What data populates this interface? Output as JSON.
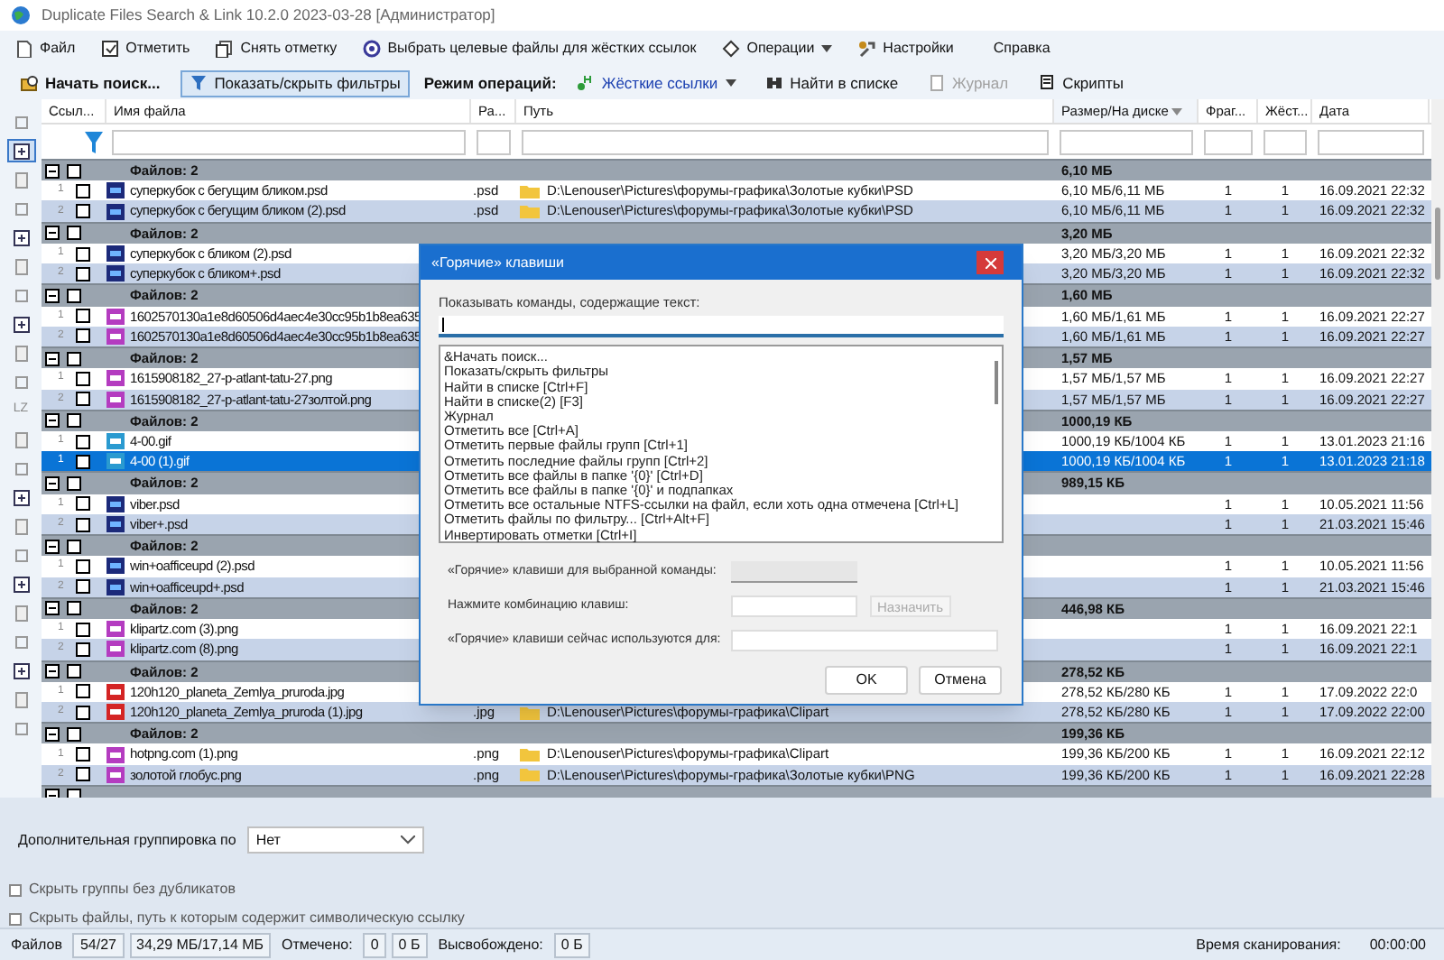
{
  "window": {
    "title": "Duplicate Files Search & Link 10.2.0 2023-03-28 [Администратор]"
  },
  "menu": [
    {
      "label": "Файл",
      "kind": "item"
    },
    {
      "label": "Отметить",
      "kind": "item"
    },
    {
      "label": "Снять отметку",
      "kind": "item"
    },
    {
      "label": "Выбрать целевые файлы для жёстких ссылок",
      "kind": "item"
    },
    {
      "label": "Операции",
      "kind": "dropdown"
    },
    {
      "label": "Настройки",
      "kind": "item"
    },
    {
      "label": "Справка",
      "kind": "plain"
    }
  ],
  "toolbar": [
    {
      "label": "Начать поиск...",
      "kind": "primary",
      "pressed": false,
      "disabled": false
    },
    {
      "label": "Показать/скрыть фильтры",
      "kind": "button",
      "pressed": true,
      "disabled": false
    },
    {
      "label": "Режим операций:",
      "kind": "label"
    },
    {
      "label": "Жёсткие ссылки",
      "kind": "dropdown",
      "pressed": false,
      "disabled": false
    },
    {
      "label": "Найти в списке",
      "kind": "button",
      "pressed": false,
      "disabled": false
    },
    {
      "label": "Журнал",
      "kind": "button",
      "pressed": false,
      "disabled": true
    },
    {
      "label": "Скрипты",
      "kind": "button",
      "pressed": false,
      "disabled": false
    }
  ],
  "left_toolbar": [
    {
      "pressed": false
    },
    {
      "pressed": true
    },
    {
      "pressed": false
    },
    {
      "pressed": false
    },
    {
      "pressed": false
    },
    {
      "pressed": false
    },
    {
      "pressed": false
    },
    {
      "pressed": false
    },
    {
      "pressed": false
    },
    {
      "pressed": false
    },
    {
      "label": "LZ",
      "pressed": false
    },
    {
      "pressed": false
    },
    {
      "pressed": false
    },
    {
      "pressed": false
    },
    {
      "pressed": false
    },
    {
      "pressed": false
    },
    {
      "pressed": false
    },
    {
      "pressed": false
    },
    {
      "pressed": false
    },
    {
      "pressed": false
    },
    {
      "pressed": false
    },
    {
      "pressed": false
    }
  ],
  "table": {
    "columns": [
      {
        "label": "Ссыл...",
        "sorted": false
      },
      {
        "label": "Имя файла",
        "sorted": false
      },
      {
        "label": "Ра...",
        "sorted": false
      },
      {
        "label": "Путь",
        "sorted": false
      },
      {
        "label": "Размер/На диске",
        "sorted": true
      },
      {
        "label": "Фраг...",
        "sorted": false
      },
      {
        "label": "Жёст...",
        "sorted": false
      },
      {
        "label": "Дата",
        "sorted": false
      }
    ],
    "groups": [
      {
        "label": "Файлов: 2",
        "size": "6,10 МБ",
        "expanded": true,
        "checked": false,
        "files": [
          {
            "number": "1",
            "kind": "psd",
            "name": "суперкубок с бегущим бликом.psd",
            "ext": ".psd",
            "path": "D:\\Lenouser\\Pictures\\форумы-графика\\Золотые кубки\\PSD",
            "size": "6,10 МБ/6,11 МБ",
            "fragments": "1",
            "hardlinks": "1",
            "date": "16.09.2021 22:32",
            "checked": false,
            "selected": false
          },
          {
            "number": "2",
            "kind": "psd",
            "name": "суперкубок с бегущим бликом (2).psd",
            "ext": ".psd",
            "path": "D:\\Lenouser\\Pictures\\форумы-графика\\Золотые кубки\\PSD",
            "size": "6,10 МБ/6,11 МБ",
            "fragments": "1",
            "hardlinks": "1",
            "date": "16.09.2021 22:32",
            "checked": false,
            "selected": false
          }
        ]
      },
      {
        "label": "Файлов: 2",
        "size": "3,20 МБ",
        "expanded": true,
        "checked": false,
        "files": [
          {
            "number": "1",
            "kind": "psd",
            "name": "суперкубок с бликом (2).psd",
            "size": "3,20 МБ/3,20 МБ",
            "fragments": "1",
            "hardlinks": "1",
            "date": "16.09.2021 22:32",
            "checked": false,
            "selected": false
          },
          {
            "number": "2",
            "kind": "psd",
            "name": "суперкубок с бликом+.psd",
            "size": "3,20 МБ/3,20 МБ",
            "fragments": "1",
            "hardlinks": "1",
            "date": "16.09.2021 22:32",
            "checked": false,
            "selected": false
          }
        ]
      },
      {
        "label": "Файлов: 2",
        "size": "1,60 МБ",
        "expanded": true,
        "checked": false,
        "files": [
          {
            "number": "1",
            "kind": "png",
            "name": "1602570130a1e8d60506d4aec4e30cc95b1b8ea635",
            "size": "1,60 МБ/1,61 МБ",
            "fragments": "1",
            "hardlinks": "1",
            "date": "16.09.2021 22:27",
            "checked": false,
            "selected": false
          },
          {
            "number": "2",
            "kind": "png",
            "name": "1602570130a1e8d60506d4aec4e30cc95b1b8ea635",
            "size": "1,60 МБ/1,61 МБ",
            "fragments": "1",
            "hardlinks": "1",
            "date": "16.09.2021 22:27",
            "checked": false,
            "selected": false
          }
        ]
      },
      {
        "label": "Файлов: 2",
        "size": "1,57 МБ",
        "expanded": true,
        "checked": false,
        "files": [
          {
            "number": "1",
            "kind": "png",
            "name": "1615908182_27-p-atlant-tatu-27.png",
            "size": "1,57 МБ/1,57 МБ",
            "fragments": "1",
            "hardlinks": "1",
            "date": "16.09.2021 22:27",
            "checked": false,
            "selected": false
          },
          {
            "number": "2",
            "kind": "png",
            "name": "1615908182_27-p-atlant-tatu-27золтой.png",
            "size": "1,57 МБ/1,57 МБ",
            "fragments": "1",
            "hardlinks": "1",
            "date": "16.09.2021 22:27",
            "checked": false,
            "selected": false
          }
        ]
      },
      {
        "label": "Файлов: 2",
        "size": "1000,19 КБ",
        "expanded": true,
        "checked": false,
        "files": [
          {
            "number": "1",
            "kind": "gif",
            "name": "4-00.gif",
            "size": "1000,19 КБ/1004 КБ",
            "fragments": "1",
            "hardlinks": "1",
            "date": "13.01.2023 21:16",
            "checked": false,
            "selected": false
          },
          {
            "number": "1",
            "kind": "gif",
            "name": "4-00 (1).gif",
            "size": "1000,19 КБ/1004 КБ",
            "fragments": "1",
            "hardlinks": "1",
            "date": "13.01.2023 21:18",
            "checked": false,
            "selected": true
          }
        ]
      },
      {
        "label": "Файлов: 2",
        "size": "989,15 КБ",
        "expanded": true,
        "checked": false,
        "files": [
          {
            "number": "1",
            "kind": "psd",
            "name": "viber.psd",
            "fragments": "1",
            "hardlinks": "1",
            "date": "10.05.2021 11:56",
            "checked": false,
            "selected": false
          },
          {
            "number": "2",
            "kind": "psd",
            "name": "viber+.psd",
            "fragments": "1",
            "hardlinks": "1",
            "date": "21.03.2021 15:46",
            "checked": false,
            "selected": false
          }
        ]
      },
      {
        "label": "Файлов: 2",
        "expanded": true,
        "checked": false,
        "files": [
          {
            "number": "1",
            "kind": "psd",
            "name": "win+oafficeupd (2).psd",
            "fragments": "1",
            "hardlinks": "1",
            "date": "10.05.2021 11:56",
            "checked": false,
            "selected": false
          },
          {
            "number": "2",
            "kind": "psd",
            "name": "win+oafficeupd+.psd",
            "fragments": "1",
            "hardlinks": "1",
            "date": "21.03.2021 15:46",
            "checked": false,
            "selected": false
          }
        ]
      },
      {
        "label": "Файлов: 2",
        "size": "446,98 КБ",
        "expanded": true,
        "checked": false,
        "files": [
          {
            "number": "1",
            "kind": "png",
            "name": "klipartz.com (3).png",
            "fragments": "1",
            "hardlinks": "1",
            "date": "16.09.2021 22:1",
            "checked": false,
            "selected": false
          },
          {
            "number": "2",
            "kind": "png",
            "name": "klipartz.com (8).png",
            "fragments": "1",
            "hardlinks": "1",
            "date": "16.09.2021 22:1",
            "checked": false,
            "selected": false
          }
        ]
      },
      {
        "label": "Файлов: 2",
        "size": "278,52 КБ",
        "expanded": true,
        "checked": false,
        "files": [
          {
            "number": "1",
            "kind": "jpg",
            "name": "120h120_planeta_Zemlya_pruroda.jpg",
            "size": "278,52 КБ/280 КБ",
            "fragments": "1",
            "hardlinks": "1",
            "date": "17.09.2022 22:0",
            "checked": false,
            "selected": false
          },
          {
            "number": "2",
            "kind": "jpg",
            "name": "120h120_planeta_Zemlya_pruroda (1).jpg",
            "ext": ".jpg",
            "path": "D:\\Lenouser\\Pictures\\форумы-графика\\Clipart",
            "size": "278,52 КБ/280 КБ",
            "fragments": "1",
            "hardlinks": "1",
            "date": "17.09.2022 22:00",
            "checked": false,
            "selected": false
          }
        ]
      },
      {
        "label": "Файлов: 2",
        "size": "199,36 КБ",
        "expanded": true,
        "checked": false,
        "files": [
          {
            "number": "1",
            "kind": "png",
            "name": "hotpng.com (1).png",
            "ext": ".png",
            "path": "D:\\Lenouser\\Pictures\\форумы-графика\\Clipart",
            "size": "199,36 КБ/200 КБ",
            "fragments": "1",
            "hardlinks": "1",
            "date": "16.09.2021 22:12",
            "checked": false,
            "selected": false
          },
          {
            "number": "2",
            "kind": "png",
            "name": "золотой глобус.png",
            "ext": ".png",
            "path": "D:\\Lenouser\\Pictures\\форумы-графика\\Золотые кубки\\PNG",
            "size": "199,36 КБ/200 КБ",
            "fragments": "1",
            "hardlinks": "1",
            "date": "16.09.2021 22:28",
            "checked": false,
            "selected": false
          }
        ]
      },
      {
        "expanded": true,
        "checked": false
      }
    ]
  },
  "grouping": {
    "label": "Дополнительная группировка по",
    "value": "Нет"
  },
  "options": [
    {
      "label": "Скрыть группы без дубликатов",
      "checked": false
    },
    {
      "label": "Скрыть файлы, путь к которым содержит символическую ссылку",
      "checked": false
    }
  ],
  "status_bar": {
    "left": [
      {
        "text": "Файлов",
        "boxed": false
      },
      {
        "text": "54/27",
        "boxed": true
      },
      {
        "text": "34,29 МБ/17,14 МБ",
        "boxed": true
      },
      {
        "text": "Отмечено:",
        "boxed": false
      },
      {
        "text": "0",
        "boxed": true
      },
      {
        "text": "0 Б",
        "boxed": true
      },
      {
        "text": "Высвобождено:",
        "boxed": false
      },
      {
        "text": "0 Б",
        "boxed": true
      }
    ],
    "right": [
      {
        "text": "Время сканирования:",
        "boxed": false
      },
      {
        "text": "00:00:00",
        "boxed": false
      }
    ]
  },
  "dialog": {
    "title": "«Горячие» клавиши",
    "filter_label": "Показывать команды, содержащие текст:",
    "commands": [
      "&Начать поиск...",
      "Показать/скрыть фильтры",
      "Найти в списке [Ctrl+F]",
      "Найти в списке(2) [F3]",
      "Журнал",
      "Отметить все [Ctrl+A]",
      "Отметить первые файлы групп [Ctrl+1]",
      "Отметить последние файлы групп [Ctrl+2]",
      "Отметить все файлы в папке '{0}' [Ctrl+D]",
      "Отметить все файлы в папке '{0}' и подпапках",
      "Отметить все остальные NTFS-ссылки на файл, если хоть одна отмечена [Ctrl+L]",
      "Отметить файлы по фильтру... [Ctrl+Alt+F]",
      "Инвертировать отметки [Ctrl+I]"
    ],
    "fields": [
      {
        "label": "«Горячие» клавиши для выбранной команды:",
        "disabled": true
      },
      {
        "label": "Нажмите комбинацию клавиш:",
        "disabled": false
      },
      {
        "label": "«Горячие» клавиши сейчас используются для:",
        "disabled": false
      }
    ],
    "assign_button": {
      "label": "Назначить",
      "disabled": true
    },
    "buttons": [
      "OK",
      "Отмена"
    ]
  }
}
